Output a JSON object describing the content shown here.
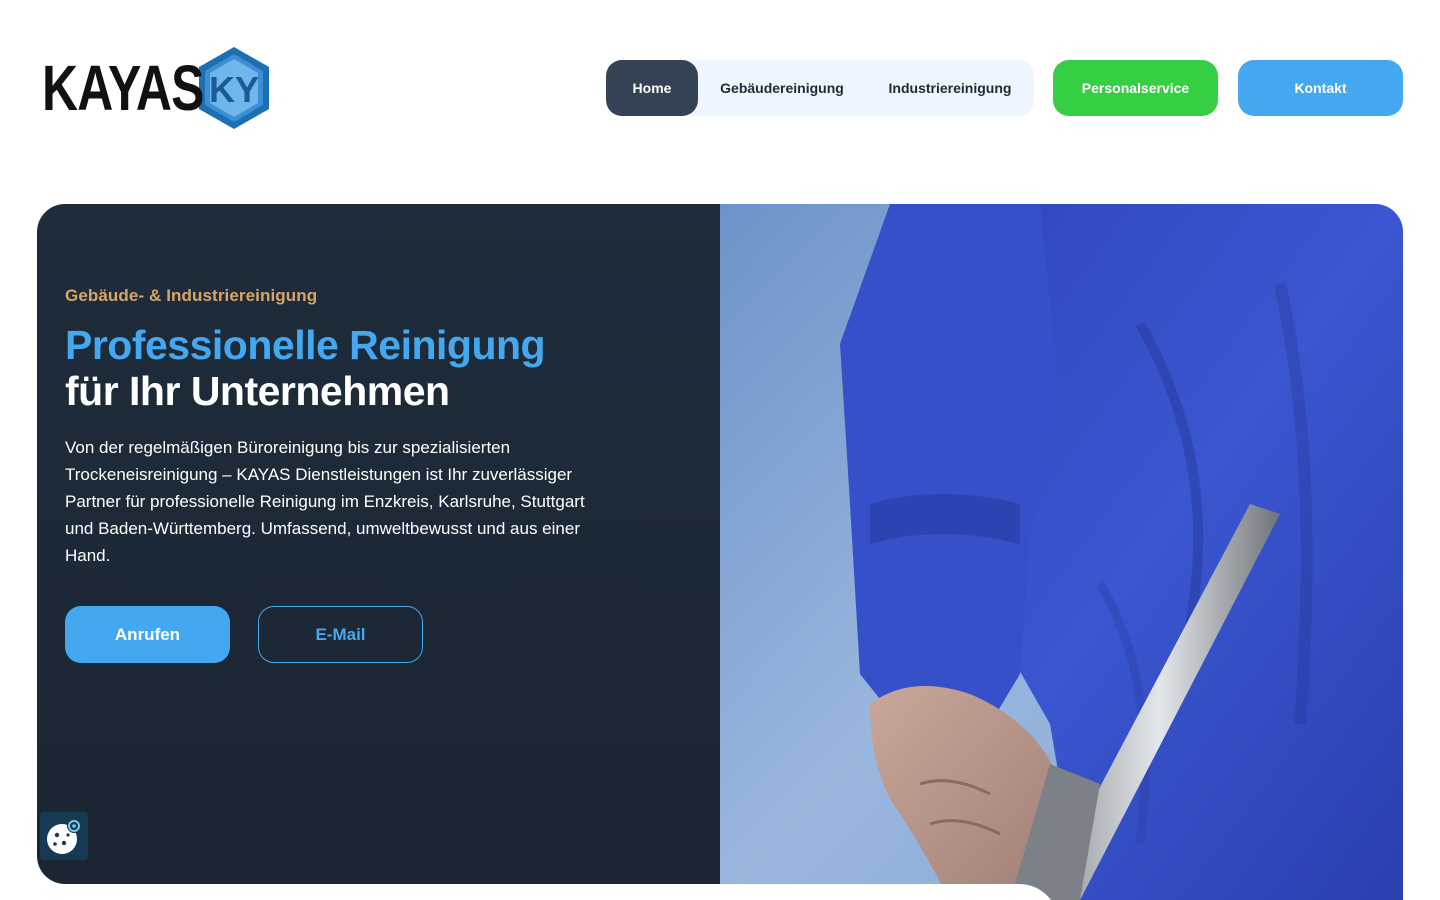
{
  "header": {
    "logo_text": "KAYAS",
    "logo_mark": "KY",
    "nav": [
      {
        "label": "Home",
        "active": true
      },
      {
        "label": "Gebäudereinigung",
        "active": false
      },
      {
        "label": "Industriereinigung",
        "active": false
      }
    ],
    "personal_label": "Personalservice",
    "kontakt_label": "Kontakt"
  },
  "hero": {
    "eyebrow": "Gebäude- & Industriereinigung",
    "headline_line1": "Professionelle Reinigung",
    "headline_line2": "für Ihr Unternehmen",
    "intro": "Von der regelmäßigen Büroreinigung bis zur spezialisierten Trockeneisreinigung – KAYAS Dienstleistungen ist Ihr zuverlässiger Partner für professionelle Reinigung im Enzkreis, Karlsruhe, Stuttgart und Baden-Württemberg. Umfassend, umweltbewusst und aus einer Hand.",
    "cta_call": "Anrufen",
    "cta_mail": "E-Mail"
  },
  "cookie": {
    "icon": "cookie-settings-icon"
  },
  "colors": {
    "accent_blue": "#43a8f0",
    "green": "#36cf44",
    "dark_panel": "#1e2c3b",
    "eyebrow": "#d9a467",
    "nav_active": "#344255"
  }
}
